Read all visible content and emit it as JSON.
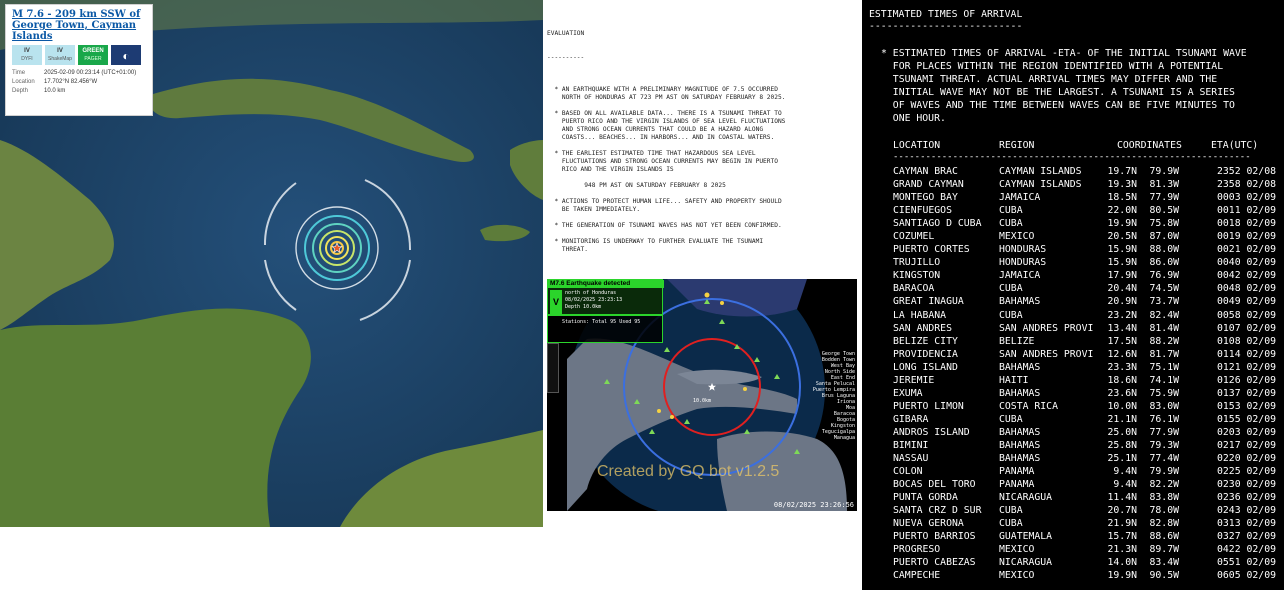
{
  "usgs_card": {
    "title": "M 7.6 - 209 km SSW of George Town, Cayman Islands",
    "badges": [
      {
        "top": "IV",
        "bottom": "DYFI"
      },
      {
        "top": "IV",
        "bottom": "ShakeMap"
      },
      {
        "top": "GREEN",
        "bottom": "PAGER"
      }
    ],
    "fields": [
      {
        "key": "Time",
        "value": "2025-02-09 00:23:14 (UTC+01:00)"
      },
      {
        "key": "Location",
        "value": "17.702°N 82.456°W"
      },
      {
        "key": "Depth",
        "value": "10.0 km"
      }
    ],
    "colors": {
      "title": "#0a58a5",
      "pager": "#19a74a"
    }
  },
  "evaluation": {
    "heading": "EVALUATION",
    "underline": "----------",
    "lines": [
      "",
      "  * AN EARTHQUAKE WITH A PRELIMINARY MAGNITUDE OF 7.5 OCCURRED",
      "    NORTH OF HONDURAS AT 723 PM AST ON SATURDAY FEBRUARY 8 2025.",
      "",
      "  * BASED ON ALL AVAILABLE DATA... THERE IS A TSUNAMI THREAT TO",
      "    PUERTO RICO AND THE VIRGIN ISLANDS OF SEA LEVEL FLUCTUATIONS",
      "    AND STRONG OCEAN CURRENTS THAT COULD BE A HAZARD ALONG",
      "    COASTS... BEACHES... IN HARBORS... AND IN COASTAL WATERS.",
      "",
      "  * THE EARLIEST ESTIMATED TIME THAT HAZARDOUS SEA LEVEL",
      "    FLUCTUATIONS AND STRONG OCEAN CURRENTS MAY BEGIN IN PUERTO",
      "    RICO AND THE VIRGIN ISLANDS IS",
      "",
      "          948 PM AST ON SATURDAY FEBRUARY 8 2025",
      "",
      "  * ACTIONS TO PROTECT HUMAN LIFE... SAFETY AND PROPERTY SHOULD",
      "    BE TAKEN IMMEDIATELY.",
      "",
      "  * THE GENERATION OF TSUNAMI WAVES HAS NOT YET BEEN CONFIRMED.",
      "",
      "  * MONITORING IS UNDERWAY TO FURTHER EVALUATE THE TSUNAMI",
      "    THREAT."
    ]
  },
  "radar": {
    "title": "M7.6 Earthquake detected",
    "level": "V",
    "region": "north of Honduras",
    "datetime": "08/02/2025 23:23:13",
    "stations": "Stations: Total 95 Used 95",
    "depth": "Depth 10.0km",
    "epicenter_label": "10.0km",
    "watermark": "Created by GQ bot v1.2.5",
    "timestamp": "08/02/2025 23:26:56",
    "legend": [
      "George Town",
      "Bodden Town",
      "West Bay",
      "North Side",
      "East End",
      "Santa Pelucal",
      "Puerto Lempira",
      "Brus Laguna",
      "Iriona",
      "Moa",
      "Baracoa",
      "Bogota",
      "Kingston",
      "Tegucigalpa",
      "Managua"
    ]
  },
  "eta": {
    "heading": "ESTIMATED TIMES OF ARRIVAL",
    "underline": "--------------------------",
    "note": [
      "* ESTIMATED TIMES OF ARRIVAL -ETA- OF THE INITIAL TSUNAMI WAVE",
      "  FOR PLACES WITHIN THE REGION IDENTIFIED WITH A POTENTIAL",
      "  TSUNAMI THREAT. ACTUAL ARRIVAL TIMES MAY DIFFER AND THE",
      "  INITIAL WAVE MAY NOT BE THE LARGEST. A TSUNAMI IS A SERIES",
      "  OF WAVES AND THE TIME BETWEEN WAVES CAN BE FIVE MINUTES TO",
      "  ONE HOUR."
    ],
    "columns": {
      "location": "LOCATION",
      "region": "REGION",
      "coordinates": "COORDINATES",
      "eta": "ETA(UTC)"
    },
    "rule": "------------------------------------------------------------------",
    "rows": [
      {
        "location": "CAYMAN BRAC",
        "region": "CAYMAN ISLANDS",
        "lat": "19.7N",
        "lon": "79.9W",
        "eta": "2352 02/08"
      },
      {
        "location": "GRAND CAYMAN",
        "region": "CAYMAN ISLANDS",
        "lat": "19.3N",
        "lon": "81.3W",
        "eta": "2358 02/08"
      },
      {
        "location": "MONTEGO BAY",
        "region": "JAMAICA",
        "lat": "18.5N",
        "lon": "77.9W",
        "eta": "0003 02/09"
      },
      {
        "location": "CIENFUEGOS",
        "region": "CUBA",
        "lat": "22.0N",
        "lon": "80.5W",
        "eta": "0011 02/09"
      },
      {
        "location": "SANTIAGO D CUBA",
        "region": "CUBA",
        "lat": "19.9N",
        "lon": "75.8W",
        "eta": "0018 02/09"
      },
      {
        "location": "COZUMEL",
        "region": "MEXICO",
        "lat": "20.5N",
        "lon": "87.0W",
        "eta": "0019 02/09"
      },
      {
        "location": "PUERTO CORTES",
        "region": "HONDURAS",
        "lat": "15.9N",
        "lon": "88.0W",
        "eta": "0021 02/09"
      },
      {
        "location": "TRUJILLO",
        "region": "HONDURAS",
        "lat": "15.9N",
        "lon": "86.0W",
        "eta": "0040 02/09"
      },
      {
        "location": "KINGSTON",
        "region": "JAMAICA",
        "lat": "17.9N",
        "lon": "76.9W",
        "eta": "0042 02/09"
      },
      {
        "location": "BARACOA",
        "region": "CUBA",
        "lat": "20.4N",
        "lon": "74.5W",
        "eta": "0048 02/09"
      },
      {
        "location": "GREAT INAGUA",
        "region": "BAHAMAS",
        "lat": "20.9N",
        "lon": "73.7W",
        "eta": "0049 02/09"
      },
      {
        "location": "LA HABANA",
        "region": "CUBA",
        "lat": "23.2N",
        "lon": "82.4W",
        "eta": "0058 02/09"
      },
      {
        "location": "SAN ANDRES",
        "region": "SAN ANDRES PROVI",
        "lat": "13.4N",
        "lon": "81.4W",
        "eta": "0107 02/09"
      },
      {
        "location": "BELIZE CITY",
        "region": "BELIZE",
        "lat": "17.5N",
        "lon": "88.2W",
        "eta": "0108 02/09"
      },
      {
        "location": "PROVIDENCIA",
        "region": "SAN ANDRES PROVI",
        "lat": "12.6N",
        "lon": "81.7W",
        "eta": "0114 02/09"
      },
      {
        "location": "LONG ISLAND",
        "region": "BAHAMAS",
        "lat": "23.3N",
        "lon": "75.1W",
        "eta": "0121 02/09"
      },
      {
        "location": "JEREMIE",
        "region": "HAITI",
        "lat": "18.6N",
        "lon": "74.1W",
        "eta": "0126 02/09"
      },
      {
        "location": "EXUMA",
        "region": "BAHAMAS",
        "lat": "23.6N",
        "lon": "75.9W",
        "eta": "0137 02/09"
      },
      {
        "location": "PUERTO LIMON",
        "region": "COSTA RICA",
        "lat": "10.0N",
        "lon": "83.0W",
        "eta": "0153 02/09"
      },
      {
        "location": "GIBARA",
        "region": "CUBA",
        "lat": "21.1N",
        "lon": "76.1W",
        "eta": "0155 02/09"
      },
      {
        "location": "ANDROS ISLAND",
        "region": "BAHAMAS",
        "lat": "25.0N",
        "lon": "77.9W",
        "eta": "0203 02/09"
      },
      {
        "location": "BIMINI",
        "region": "BAHAMAS",
        "lat": "25.8N",
        "lon": "79.3W",
        "eta": "0217 02/09"
      },
      {
        "location": "NASSAU",
        "region": "BAHAMAS",
        "lat": "25.1N",
        "lon": "77.4W",
        "eta": "0220 02/09"
      },
      {
        "location": "COLON",
        "region": "PANAMA",
        "lat": "9.4N",
        "lon": "79.9W",
        "eta": "0225 02/09"
      },
      {
        "location": "BOCAS DEL TORO",
        "region": "PANAMA",
        "lat": "9.4N",
        "lon": "82.2W",
        "eta": "0230 02/09"
      },
      {
        "location": "PUNTA GORDA",
        "region": "NICARAGUA",
        "lat": "11.4N",
        "lon": "83.8W",
        "eta": "0236 02/09"
      },
      {
        "location": "SANTA CRZ D SUR",
        "region": "CUBA",
        "lat": "20.7N",
        "lon": "78.0W",
        "eta": "0243 02/09"
      },
      {
        "location": "NUEVA GERONA",
        "region": "CUBA",
        "lat": "21.9N",
        "lon": "82.8W",
        "eta": "0313 02/09"
      },
      {
        "location": "PUERTO BARRIOS",
        "region": "GUATEMALA",
        "lat": "15.7N",
        "lon": "88.6W",
        "eta": "0327 02/09"
      },
      {
        "location": "PROGRESO",
        "region": "MEXICO",
        "lat": "21.3N",
        "lon": "89.7W",
        "eta": "0422 02/09"
      },
      {
        "location": "PUERTO CABEZAS",
        "region": "NICARAGUA",
        "lat": "14.0N",
        "lon": "83.4W",
        "eta": "0551 02/09"
      },
      {
        "location": "CAMPECHE",
        "region": "MEXICO",
        "lat": "19.9N",
        "lon": "90.5W",
        "eta": "0605 02/09"
      }
    ]
  }
}
